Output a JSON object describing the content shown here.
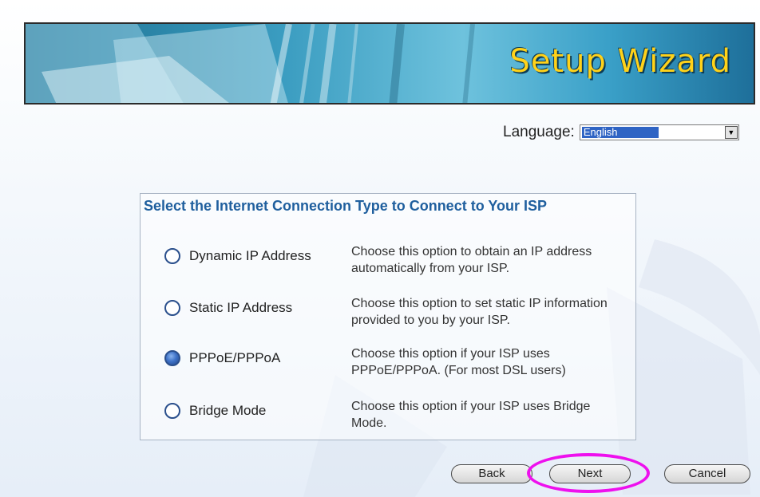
{
  "banner": {
    "title": "Setup Wizard"
  },
  "language": {
    "label": "Language:",
    "selected": "English"
  },
  "panel": {
    "heading": "Select the Internet Connection Type to Connect to Your ISP",
    "options": [
      {
        "label": "Dynamic IP Address",
        "description": "Choose this option to obtain an IP address automatically from your ISP.",
        "checked": false
      },
      {
        "label": "Static IP Address",
        "description": "Choose this option to set static IP information provided to you by your ISP.",
        "checked": false
      },
      {
        "label": "PPPoE/PPPoA",
        "description": "Choose this option if your ISP uses PPPoE/PPPoA. (For most DSL users)",
        "checked": true
      },
      {
        "label": "Bridge Mode",
        "description": "Choose this option if your ISP uses Bridge Mode.",
        "checked": false
      }
    ]
  },
  "buttons": {
    "back": "Back",
    "next": "Next",
    "cancel": "Cancel"
  },
  "colors": {
    "highlight": "#ee10ee",
    "heading": "#1f5f9e",
    "banner_title": "#ffd21a"
  }
}
